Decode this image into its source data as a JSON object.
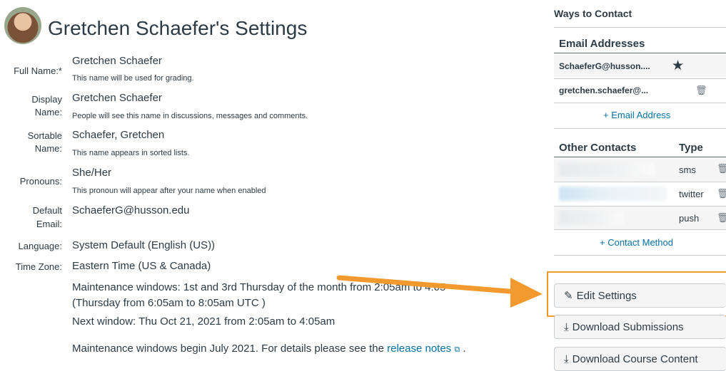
{
  "header": {
    "title": "Gretchen Schaefer's Settings"
  },
  "profile": {
    "full_name_label": "Full Name:*",
    "full_name": "Gretchen Schaefer",
    "full_name_hint": "This name will be used for grading.",
    "display_name_label_1": "Display",
    "display_name_label_2": "Name:",
    "display_name": "Gretchen Schaefer",
    "display_name_hint": "People will see this name in discussions, messages and comments.",
    "sortable_name_label_1": "Sortable",
    "sortable_name_label_2": "Name:",
    "sortable_name": "Schaefer, Gretchen",
    "sortable_name_hint": "This name appears in sorted lists.",
    "pronouns_label": "Pronouns:",
    "pronouns": "She/Her",
    "pronouns_hint": "This pronoun will appear after your name when enabled",
    "default_email_label_1": "Default",
    "default_email_label_2": "Email:",
    "default_email": "SchaeferG@husson.edu",
    "language_label": "Language:",
    "language": "System Default (English (US))",
    "timezone_label": "Time Zone:",
    "timezone": "Eastern Time (US & Canada)"
  },
  "maintenance": {
    "line1": "Maintenance windows: 1st and 3rd Thursday of the month from 2:05am to 4:05",
    "line2": "(Thursday from 6:05am to 8:05am UTC )",
    "line3": "Next window: Thu Oct 21, 2021 from 2:05am to 4:05am",
    "note_prefix": "Maintenance windows begin July 2021. For details please see the ",
    "note_link": "release notes",
    "note_suffix": " ."
  },
  "sidebar": {
    "title": "Ways to Contact",
    "email_heading": "Email Addresses",
    "emails": [
      {
        "address": "SchaeferG@husson....",
        "icon": "star-icon"
      },
      {
        "address": "gretchen.schaefer@...",
        "icon": "trash-icon"
      }
    ],
    "add_email": "+ Email Address",
    "other_heading": "Other Contacts",
    "type_heading": "Type",
    "contacts": [
      {
        "type": "sms"
      },
      {
        "type": "twitter"
      },
      {
        "type": "push"
      }
    ],
    "add_contact": "+ Contact Method",
    "buttons": {
      "edit": "Edit Settings",
      "download_submissions": "Download Submissions",
      "download_course": "Download Course Content"
    }
  },
  "colors": {
    "link": "#0770a3",
    "highlight": "#f39a2e",
    "text": "#2d3b45"
  }
}
